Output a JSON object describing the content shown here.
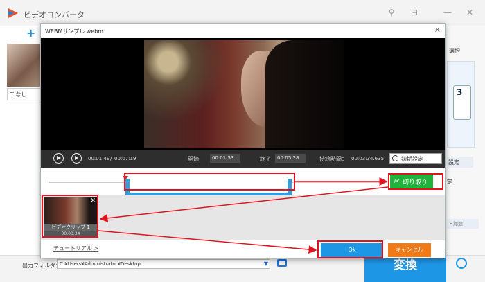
{
  "main_window": {
    "title": "ビデオコンバータ",
    "add_label": "+",
    "subtitle_none": "なし",
    "right_panel": {
      "select_label": "選択",
      "format_label": "3",
      "settings_label": "設定",
      "stop_label": "定",
      "hw_accel_label": "ド加速"
    },
    "output_folder_label": "出力フォルダ：",
    "output_folder_path": "C:¥Users¥Administrator¥Desktop",
    "convert_button": "変換"
  },
  "dialog": {
    "title": "WEBMサンプル.webm",
    "controls": {
      "current_time": "00:01:49",
      "total_time": "00:07:19",
      "start_label": "開始",
      "start_time": "00:01:53",
      "end_label": "終了",
      "end_time": "00:05:28",
      "duration_label": "持続時間：",
      "duration_value": "00:03:34.635",
      "reset_button": "初期設定"
    },
    "trim": {
      "start_fraction": 0.257,
      "end_fraction": 0.747
    },
    "cut_button": "切り取り",
    "clip": {
      "name": "ビデオクリップ 1",
      "duration": "00:03:34"
    },
    "tutorial_link": "チュートリアル >",
    "ok_button": "Ok",
    "cancel_button": "キャンセル"
  },
  "colors": {
    "accent_blue": "#1e96e6",
    "cut_green": "#20b23a",
    "cancel_orange": "#f07a18",
    "annotation_red": "#e0141e"
  }
}
